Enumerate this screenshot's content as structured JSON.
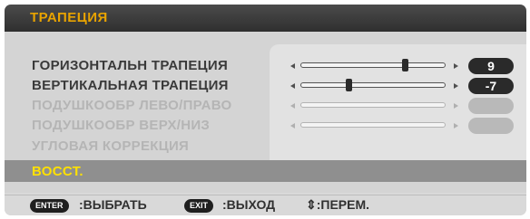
{
  "title": "ТРАПЕЦИЯ",
  "rows": [
    {
      "label": "ГОРИЗОНТАЛЬН ТРАПЕЦИЯ",
      "value": "9",
      "level": 0.72,
      "disabled": false
    },
    {
      "label": "ВЕРТИКАЛЬНАЯ ТРАПЕЦИЯ",
      "value": "-7",
      "level": 0.33,
      "disabled": false
    },
    {
      "label": "ПОДУШКООБР ЛЕВО/ПРАВО",
      "value": "",
      "level": null,
      "disabled": true
    },
    {
      "label": "ПОДУШКООБР ВЕРХ/НИЗ",
      "value": "",
      "level": null,
      "disabled": true
    },
    {
      "label": "УГЛОВАЯ КОРРЕКЦИЯ",
      "disabled": true
    }
  ],
  "reset": {
    "label": "ВОССТ."
  },
  "footer": {
    "enter_key": "ENTER",
    "enter_text": ":ВЫБРАТЬ",
    "exit_key": "EXIT",
    "exit_text": ":ВЫХОД",
    "move_text": "⇕:ПЕРЕМ."
  },
  "colors": {
    "title": "#e8a300",
    "reset_highlight": "#ffe100",
    "selected_row_bg": "#8f8f8f"
  }
}
